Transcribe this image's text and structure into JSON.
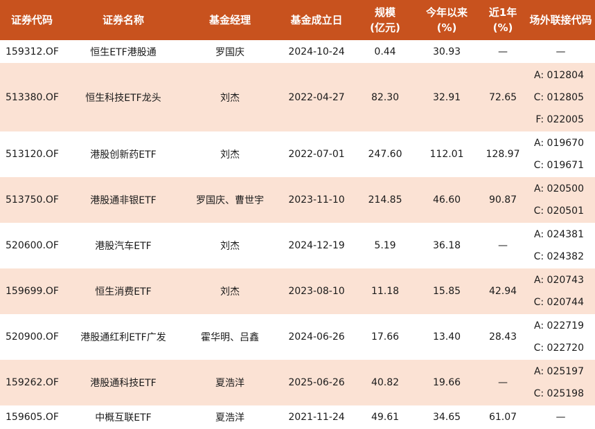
{
  "header": {
    "code": "证券代码",
    "name": "证券名称",
    "manager": "基金经理",
    "date": "基金成立日",
    "scale_line1": "规模",
    "scale_line2": "(亿元)",
    "ytd_line1": "今年以来",
    "ytd_line2": "(%)",
    "y1_line1": "近1年",
    "y1_line2": "(%)",
    "link": "场外联接代码"
  },
  "rows": [
    {
      "code": "159312.OF",
      "name": "恒生ETF港股通",
      "manager": "罗国庆",
      "date": "2024-10-24",
      "scale": "0.44",
      "ytd": "30.93",
      "y1": "—",
      "links": [
        "—"
      ]
    },
    {
      "code": "513380.OF",
      "name": "恒生科技ETF龙头",
      "manager": "刘杰",
      "date": "2022-04-27",
      "scale": "82.30",
      "ytd": "32.91",
      "y1": "72.65",
      "links": [
        "A: 012804",
        "C: 012805",
        "F: 022005"
      ]
    },
    {
      "code": "513120.OF",
      "name": "港股创新药ETF",
      "manager": "刘杰",
      "date": "2022-07-01",
      "scale": "247.60",
      "ytd": "112.01",
      "y1": "128.97",
      "links": [
        "A: 019670",
        "C: 019671"
      ]
    },
    {
      "code": "513750.OF",
      "name": "港股通非银ETF",
      "manager": "罗国庆、曹世宇",
      "date": "2023-11-10",
      "scale": "214.85",
      "ytd": "46.60",
      "y1": "90.87",
      "links": [
        "A: 020500",
        "C: 020501"
      ]
    },
    {
      "code": "520600.OF",
      "name": "港股汽车ETF",
      "manager": "刘杰",
      "date": "2024-12-19",
      "scale": "5.19",
      "ytd": "36.18",
      "y1": "—",
      "links": [
        "A: 024381",
        "C: 024382"
      ]
    },
    {
      "code": "159699.OF",
      "name": "恒生消费ETF",
      "manager": "刘杰",
      "date": "2023-08-10",
      "scale": "11.18",
      "ytd": "15.85",
      "y1": "42.94",
      "links": [
        "A: 020743",
        "C: 020744"
      ]
    },
    {
      "code": "520900.OF",
      "name": "港股通红利ETF广发",
      "manager": "霍华明、吕鑫",
      "date": "2024-06-26",
      "scale": "17.66",
      "ytd": "13.40",
      "y1": "28.43",
      "links": [
        "A: 022719",
        "C: 022720"
      ]
    },
    {
      "code": "159262.OF",
      "name": "港股通科技ETF",
      "manager": "夏浩洋",
      "date": "2025-06-26",
      "scale": "40.82",
      "ytd": "19.66",
      "y1": "—",
      "links": [
        "A: 025197",
        "C: 025198"
      ]
    },
    {
      "code": "159605.OF",
      "name": "中概互联ETF",
      "manager": "夏浩洋",
      "date": "2021-11-24",
      "scale": "49.61",
      "ytd": "34.65",
      "y1": "61.07",
      "links": [
        "—"
      ]
    }
  ]
}
